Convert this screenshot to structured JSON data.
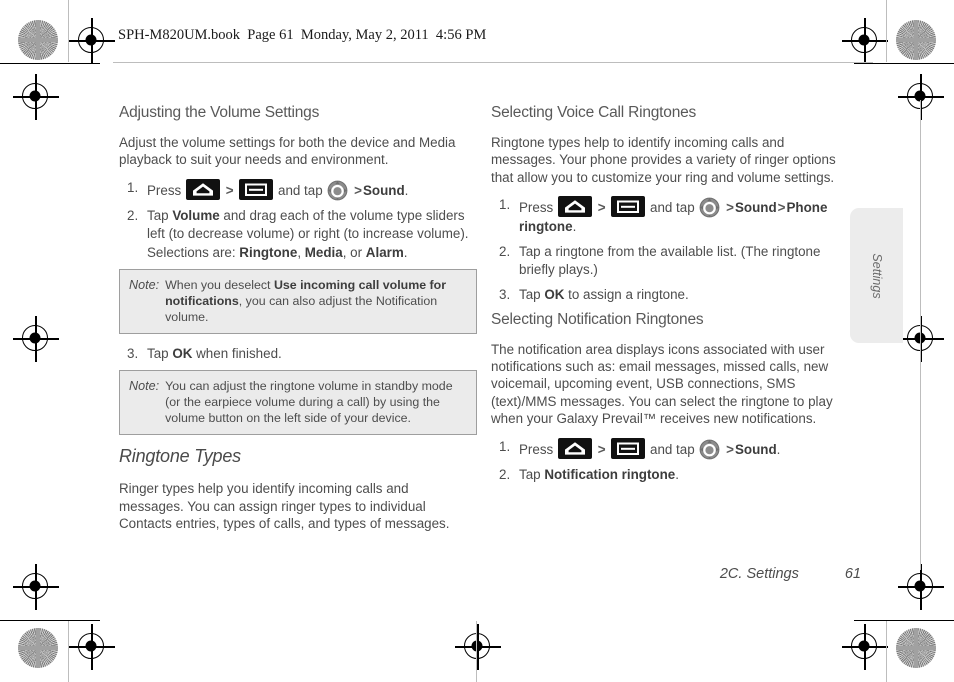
{
  "header": {
    "file_line": "SPH-M820UM.book  Page 61  Monday, May 2, 2011  4:56 PM"
  },
  "icons": {
    "home": "home-icon",
    "menu": "menu-icon",
    "settings": "settings-gear-icon",
    "separator": ">"
  },
  "side_tab": {
    "label": "Settings"
  },
  "footer": {
    "chapter": "2C. Settings",
    "page_number": "61"
  },
  "left_column": {
    "heading": "Adjusting the Volume Settings",
    "intro": "Adjust the volume settings for both the device and Media playback to suit your needs and environment.",
    "steps": [
      {
        "num": "1.",
        "pre": "Press",
        "mid": "and tap",
        "tail_bold": "Sound",
        "tail_end": "."
      },
      {
        "num": "2.",
        "text_a": "Tap ",
        "bold_a": "Volume",
        "text_b": " and drag each of the volume type sliders left (to decrease volume) or right (to increase volume). Selections are: ",
        "bold_b": "Ringtone",
        "text_c": ", ",
        "bold_c": "Media",
        "text_d": ", or ",
        "bold_d": "Alarm",
        "text_e": "."
      },
      {
        "num": "3.",
        "text_a": "Tap ",
        "bold_a": "OK",
        "text_b": " when finished."
      }
    ],
    "note_1": {
      "label": "Note:",
      "text_a": "When you deselect ",
      "bold_a": "Use incoming call volume for notifications",
      "text_b": ", you can also adjust the Notification volume."
    },
    "note_2": {
      "label": "Note:",
      "text_a": "You can adjust the ringtone volume in standby mode (or the earpiece volume during a call) by using the volume button on the left side of your device."
    },
    "subheading": "Ringtone Types",
    "sub_body": "Ringer types help you identify incoming calls and messages. You can assign ringer types to individual Contacts entries, types of calls, and types of messages."
  },
  "right_column": {
    "heading_1": "Selecting Voice Call Ringtones",
    "intro_1": "Ringtone types help to identify incoming calls and messages. Your phone provides a variety of ringer options that allow you to customize your ring and volume settings.",
    "steps_1": [
      {
        "num": "1.",
        "pre": "Press",
        "mid": "and tap",
        "tail_bold": "Sound",
        "tail_bold_2": "Phone ringtone",
        "tail_end": "."
      },
      {
        "num": "2.",
        "text_a": "Tap a ringtone from the available list. (The ringtone briefly plays.)"
      },
      {
        "num": "3.",
        "text_a": "Tap ",
        "bold_a": "OK",
        "text_b": " to assign a ringtone."
      }
    ],
    "heading_2": "Selecting Notification Ringtones",
    "intro_2": "The notification area displays icons associated with user notifications such as: email messages, missed calls, new voicemail, upcoming event, USB connections, SMS (text)/MMS messages. You can select the ringtone to play when your Galaxy Prevail™ receives new notifications.",
    "steps_2": [
      {
        "num": "1.",
        "pre": "Press",
        "mid": "and tap",
        "tail_bold": "Sound",
        "tail_end": "."
      },
      {
        "num": "2.",
        "text_a": "Tap ",
        "bold_a": "Notification ringtone",
        "text_b": "."
      }
    ]
  }
}
